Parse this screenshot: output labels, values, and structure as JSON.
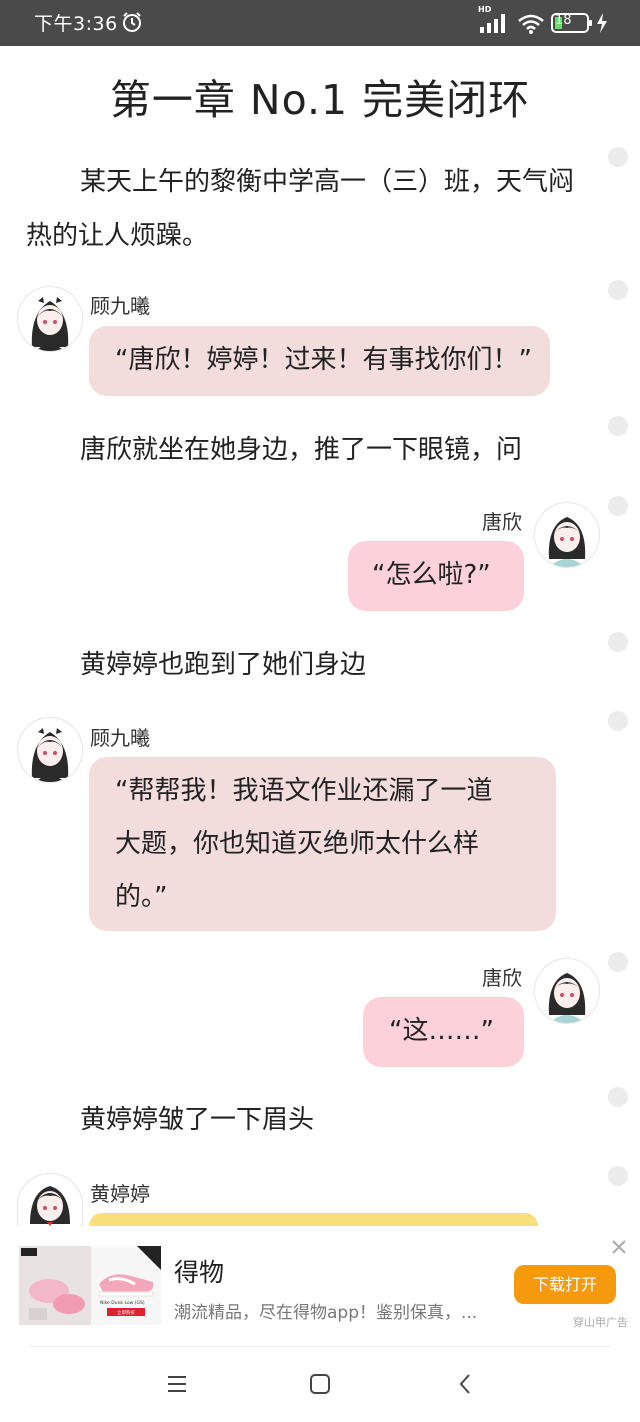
{
  "status_bar": {
    "time": "下午3:36",
    "hd": "HD",
    "battery": "18"
  },
  "chapter_title": "第一章 No.1 完美闭环",
  "story": {
    "narration_1a": "某天上午的黎衡中学高一（三）班，天气闷",
    "narration_1b": "热的让人烦躁。",
    "msg1_name": "顾九曦",
    "msg1_text": "“唐欣！婷婷！过来！有事找你们！”",
    "narration_2": "唐欣就坐在她身边，推了一下眼镜，问",
    "msg2_name": "唐欣",
    "msg2_text": "“怎么啦?”",
    "narration_3": "黄婷婷也跑到了她们身边",
    "msg3_name": "顾九曦",
    "msg3_line1": "“帮帮我！我语文作业还漏了一道",
    "msg3_line2": "大题，你也知道灭绝师太什么样",
    "msg3_line3": "的。”",
    "msg4_name": "唐欣",
    "msg4_text": "“这……”",
    "narration_4": "黄婷婷皱了一下眉头",
    "msg5_name": "黄婷婷"
  },
  "ad": {
    "title": "得物",
    "description": "潮流精品，尽在得物app！鉴别保真，...",
    "button": "下载打开",
    "tag": "穿山甲广告",
    "image_text_1": "Nike Dunk Low (GS)",
    "image_text_2": "立即购买"
  },
  "icons": {
    "alarm": "alarm-clock-icon",
    "signal": "signal-icon",
    "wifi": "wifi-icon",
    "battery": "battery-icon",
    "charging": "lightning-icon",
    "close": "close-icon",
    "menu": "menu-icon",
    "home": "home-icon",
    "back": "back-icon"
  },
  "colors": {
    "status_bar": "#4a4a4a",
    "bubble_left": "#f2dcdc",
    "bubble_right": "#fdd1d9",
    "bubble_yellow": "#f7df7a",
    "ad_button": "#f59a0c"
  }
}
